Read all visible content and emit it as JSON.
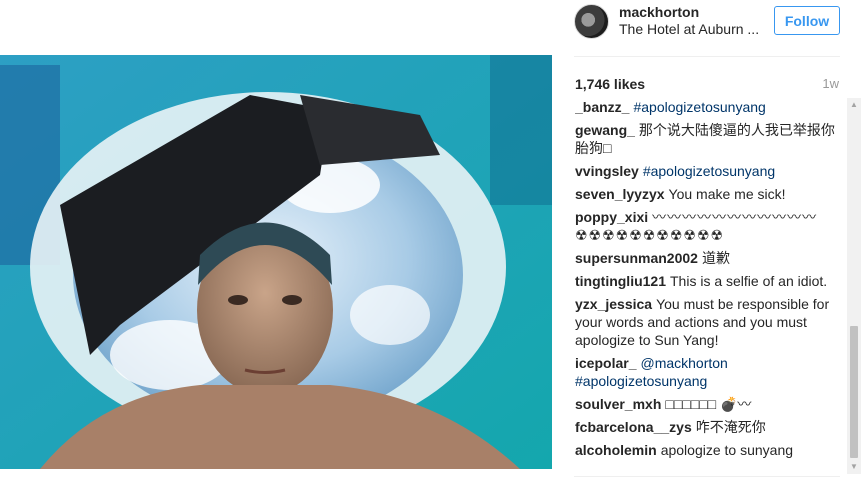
{
  "post": {
    "username": "mackhorton",
    "location": "The Hotel at Auburn ...",
    "follow_label": "Follow",
    "likes": "1,746 likes",
    "time": "1w"
  },
  "comments": [
    {
      "user": "_banzz_",
      "parts": [
        {
          "t": "tag",
          "v": "#apologizetosunyang"
        }
      ]
    },
    {
      "user": "gewang_",
      "parts": [
        {
          "t": "text",
          "v": "那个说大陆傻逼的人我已举报你 胎狗□"
        }
      ]
    },
    {
      "user": "vvingsley",
      "parts": [
        {
          "t": "tag",
          "v": "#apologizetosunyang"
        }
      ]
    },
    {
      "user": "seven_lyyzyx",
      "parts": [
        {
          "t": "text",
          "v": "You make me sick!"
        }
      ]
    },
    {
      "user": "poppy_xixi",
      "parts": [
        {
          "t": "emoji",
          "v": "〰〰〰〰〰〰〰〰〰〰〰 ☢☢☢☢☢☢☢☢☢☢☢"
        }
      ]
    },
    {
      "user": "supersunman2002",
      "parts": [
        {
          "t": "text",
          "v": "道歉"
        }
      ]
    },
    {
      "user": "tingtingliu121",
      "parts": [
        {
          "t": "text",
          "v": "This is a selfie of an idiot."
        }
      ]
    },
    {
      "user": "yzx_jessica",
      "parts": [
        {
          "t": "text",
          "v": "You must be responsible for your words and actions and you must apologize to Sun Yang!"
        }
      ]
    },
    {
      "user": "icepolar_",
      "parts": [
        {
          "t": "mention",
          "v": "@mackhorton"
        },
        {
          "t": "break",
          "v": ""
        },
        {
          "t": "tag",
          "v": "#apologizetosunyang"
        }
      ]
    },
    {
      "user": "soulver_mxh",
      "parts": [
        {
          "t": "text",
          "v": "□□□□□□ 💣〰"
        }
      ]
    },
    {
      "user": "fcbarcelona__zys",
      "parts": [
        {
          "t": "text",
          "v": "咋不淹死你"
        }
      ]
    },
    {
      "user": "alcoholemin",
      "parts": [
        {
          "t": "text",
          "v": "apologize to sunyang"
        }
      ]
    }
  ],
  "icons": {
    "photo": "underwater-selfie-image",
    "avatar": "user-avatar",
    "scroll_up": "chevron-up-icon",
    "scroll_down": "chevron-down-icon"
  },
  "colors": {
    "follow": "#3897f0",
    "hashtag": "#003569",
    "water": "#1fa8b8"
  }
}
